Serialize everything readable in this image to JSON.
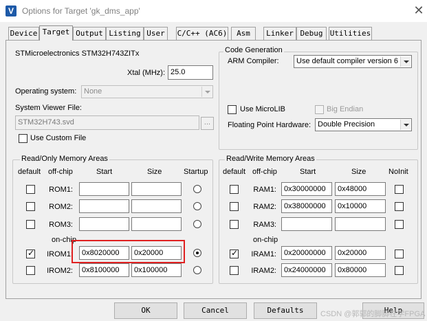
{
  "window": {
    "title": "Options for Target 'gk_dms_app'",
    "icon_letter": "V",
    "close_glyph": "✕"
  },
  "tabs": [
    {
      "label": "Device"
    },
    {
      "label": "Target"
    },
    {
      "label": "Output"
    },
    {
      "label": "Listing"
    },
    {
      "label": "User"
    },
    {
      "label": "C/C++ (AC6)"
    },
    {
      "label": "Asm"
    },
    {
      "label": "Linker"
    },
    {
      "label": "Debug"
    },
    {
      "label": "Utilities"
    }
  ],
  "target": {
    "device_name": "STMicroelectronics STM32H743ZITx",
    "xtal_label": "Xtal (MHz):",
    "xtal_value": "25.0",
    "os_label": "Operating system:",
    "os_value": "None",
    "svd_label": "System Viewer File:",
    "svd_value": "STM32H743.svd",
    "svd_browse": "...",
    "use_custom_file": "Use Custom File"
  },
  "codegen": {
    "title": "Code Generation",
    "compiler_label": "ARM Compiler:",
    "compiler_value": "Use default compiler version 6",
    "microlib": "Use MicroLIB",
    "big_endian": "Big Endian",
    "fph_label": "Floating Point Hardware:",
    "fph_value": "Double Precision"
  },
  "ro_memory": {
    "title": "Read/Only Memory Areas",
    "headers": {
      "default": "default",
      "offchip": "off-chip",
      "start": "Start",
      "size": "Size",
      "startup": "Startup"
    },
    "onchip_label": "on-chip",
    "rows": [
      {
        "name": "ROM1:",
        "start": "",
        "size": ""
      },
      {
        "name": "ROM2:",
        "start": "",
        "size": ""
      },
      {
        "name": "ROM3:",
        "start": "",
        "size": ""
      },
      {
        "name": "IROM1:",
        "start": "0x8020000",
        "size": "0x20000"
      },
      {
        "name": "IROM2:",
        "start": "0x8100000",
        "size": "0x100000"
      }
    ]
  },
  "rw_memory": {
    "title": "Read/Write Memory Areas",
    "headers": {
      "default": "default",
      "offchip": "off-chip",
      "start": "Start",
      "size": "Size",
      "noinit": "NoInit"
    },
    "onchip_label": "on-chip",
    "rows": [
      {
        "name": "RAM1:",
        "start": "0x30000000",
        "size": "0x48000"
      },
      {
        "name": "RAM2:",
        "start": "0x38000000",
        "size": "0x10000"
      },
      {
        "name": "RAM3:",
        "start": "",
        "size": ""
      },
      {
        "name": "IRAM1:",
        "start": "0x20000000",
        "size": "0x20000"
      },
      {
        "name": "IRAM2:",
        "start": "0x24000000",
        "size": "0x80000"
      }
    ]
  },
  "buttons": {
    "ok": "OK",
    "cancel": "Cancel",
    "defaults": "Defaults",
    "help": "Help"
  },
  "watermark": "CSDN @郭郭的脚脚在学FPGA",
  "colors": {
    "highlight": "#e02020",
    "title_text": "#808080"
  }
}
